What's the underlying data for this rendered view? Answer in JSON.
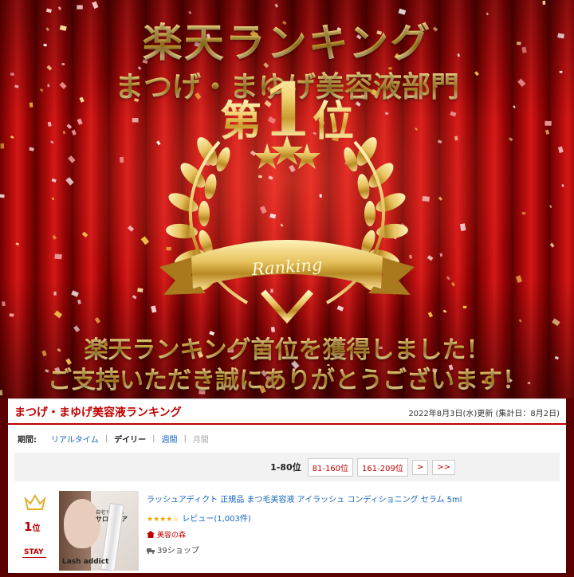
{
  "banner": {
    "title": "楽天ランキング",
    "subtitle": "まつげ・まゆげ美容液部門",
    "rank_dai": "第",
    "rank_num": "1",
    "rank_i": "位",
    "ribbon": "Ranking",
    "message1": "楽天ランキング首位を獲得しました！",
    "message2": "ご支持いただき誠にありがとうございます！"
  },
  "panel": {
    "title": "まつげ・まゆげ美容液ランキング",
    "updated": "2022年8月3日(水)更新 (集計日：8月2日)",
    "period_label": "期間:",
    "periods": [
      "リアルタイム",
      "デイリー",
      "週間",
      "月間"
    ],
    "pager": {
      "current": "1-80位",
      "pages": [
        "81-160位",
        "161-209位",
        ">",
        ">>"
      ]
    },
    "item": {
      "rank": "1",
      "rank_suffix": "位",
      "status": "STAY",
      "name": "ラッシュアディクト 正規品 まつ毛美容液 アイラッシュ コンディショニング セラム 5ml",
      "stars": "★★★★☆",
      "review": "レビュー(1,003件)",
      "shop": "美容の森",
      "shop_count": "39ショップ",
      "thumb_text1": "自宅でできる",
      "thumb_text2": "サロンケア",
      "thumb_brand": "Lash addict"
    }
  },
  "colors": {
    "accent": "#bf0000",
    "link": "#1565c0",
    "gold": "#d8ad45"
  }
}
